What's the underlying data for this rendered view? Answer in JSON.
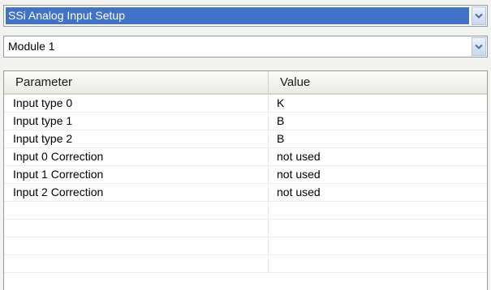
{
  "setup_select": {
    "value": "SSi Analog Input Setup"
  },
  "module_select": {
    "value": "Module 1"
  },
  "grid": {
    "columns": [
      "Parameter",
      "Value"
    ],
    "rows": [
      {
        "parameter": "Input type 0",
        "value": "K"
      },
      {
        "parameter": "Input type 1",
        "value": "B"
      },
      {
        "parameter": "Input type 2",
        "value": "B"
      },
      {
        "parameter": "Input 0 Correction",
        "value": "not used"
      },
      {
        "parameter": "Input 1 Correction",
        "value": "not used"
      },
      {
        "parameter": "Input 2 Correction",
        "value": "not used"
      },
      {
        "parameter": "",
        "value": ""
      },
      {
        "parameter": "",
        "value": ""
      },
      {
        "parameter": "",
        "value": ""
      },
      {
        "parameter": "",
        "value": ""
      }
    ]
  },
  "icons": {
    "dropdown": "chevron-down-icon"
  },
  "colors": {
    "selection": "#3f72c8",
    "arrow": "#4d6fa8"
  }
}
